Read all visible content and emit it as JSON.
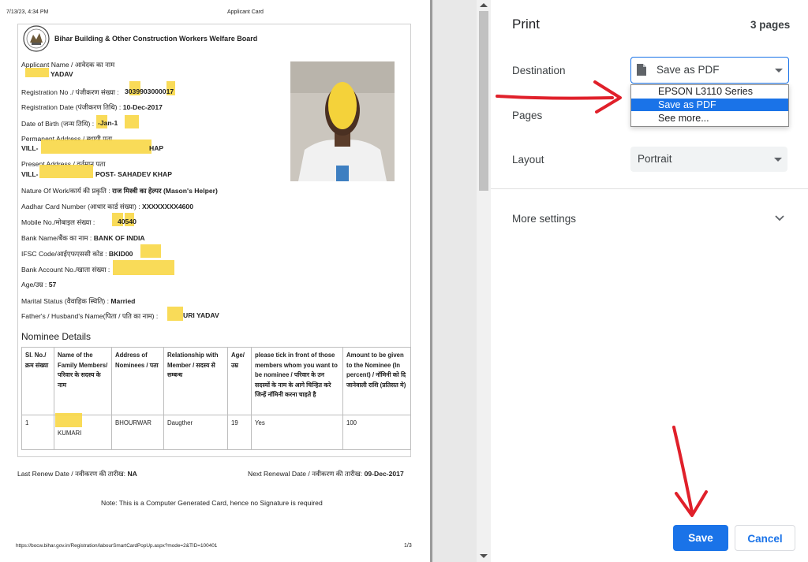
{
  "preview": {
    "header_date": "7/13/23, 4:34 PM",
    "header_title": "Applicant Card",
    "board_name": "Bihar Building & Other Construction Workers Welfare Board",
    "fields": {
      "applicant_label": "Applicant Name / आवेदक का नाम",
      "applicant_value": "YADAV",
      "registration_no_label": "Registration No ./ पंजीकरण संख्या :",
      "registration_no_value": "3039903000017",
      "registration_date_label": "Registration Date (पंजीकरण तिथि) :",
      "registration_date_value": "10-Dec-2017",
      "dob_label": "Date of Birth (जन्म तिथि) :",
      "dob_value": "-Jan-1",
      "permanent_address_label": "Permanent Address / स्थायी पता",
      "permanent_address_value": "VILL-",
      "permanent_address_tail": "HAP",
      "present_address_label": "Present Address / वर्तमान पता",
      "present_address_value": "VILL-",
      "present_address_tail": "POST- SAHADEV KHAP",
      "nature_of_work_label": "Nature Of Work/कार्य की प्रकृति :",
      "nature_of_work_value": "राज मिस्त्री का हेल्पर (Mason's Helper)",
      "aadhar_label": "Aadhar Card Number (आधार कार्ड संख्या) :",
      "aadhar_value": "XXXXXXXX4600",
      "mobile_label": "Mobile No./मोबाइल संख्या :",
      "mobile_value": "40540",
      "bank_name_label": "Bank Name/बैंक का नाम :",
      "bank_name_value": "BANK OF INDIA",
      "ifsc_label": "IFSC Code/आईएफएससी कोड :",
      "ifsc_value": "BKID00",
      "bank_account_label": "Bank Account No./खाता संख्या :",
      "age_label": "Age/उम्र :",
      "age_value": "57",
      "marital_label": "Marital Status (वैवाहिक स्थिति) :",
      "marital_value": "Married",
      "father_label": "Father's / Husband's Name(पिता / पति का नाम) :",
      "father_value": "URI YADAV"
    },
    "nominee_heading": "Nominee Details",
    "nominee_headers": [
      "Sl. No./ क्रम संख्या",
      "Name of the Family Members/ परिवार के सदस्य के नाम",
      "Address of Nominees / पता",
      "Relationship with Member / सदस्य से सम्बन्ध",
      "Age/ उम्र",
      "please tick in front of those members whom you want to be nominee / परिवार के उन सदस्यों के नाम के आगे चिन्हित करे जिन्हें नॉमिनी करना चाहते है",
      "Amount to be given to the Nominee (In percent) / नॉमिनी को दि जानेवाली राशि (प्रतिसत मे)"
    ],
    "nominee_row": [
      "1",
      "KUMARI",
      "BHOURWAR",
      "Daugther",
      "19",
      "Yes",
      "100"
    ],
    "last_renew_label": "Last Renew Date / नवीकरण की तारीख:",
    "last_renew_value": "NA",
    "next_renewal_label": "Next Renewal Date / नवीकरण की तारीख:",
    "next_renewal_value": "09-Dec-2017",
    "note": "Note: This is a Computer Generated Card, hence no Signature is required",
    "footer_url": "https://bocw.bihar.gov.in/Registration/labourSmartCardPopUp.aspx?mode=2&TID=100401",
    "footer_page": "1/3"
  },
  "print_panel": {
    "title": "Print",
    "page_count": "3 pages",
    "destination_label": "Destination",
    "destination_value": "Save as PDF",
    "destination_options": [
      "EPSON L3110 Series",
      "Save as PDF",
      "See more..."
    ],
    "pages_label": "Pages",
    "layout_label": "Layout",
    "layout_value": "Portrait",
    "more_settings_label": "More settings",
    "save_label": "Save",
    "cancel_label": "Cancel"
  },
  "colors": {
    "accent": "#1a73e8",
    "highlight": "#f9d84a",
    "annotation_arrow": "#e0202a"
  },
  "icons": [
    "pdf-file-icon",
    "dropdown-caret-icon",
    "chevron-down-icon",
    "emblem-logo",
    "red-arrow-annotation"
  ]
}
